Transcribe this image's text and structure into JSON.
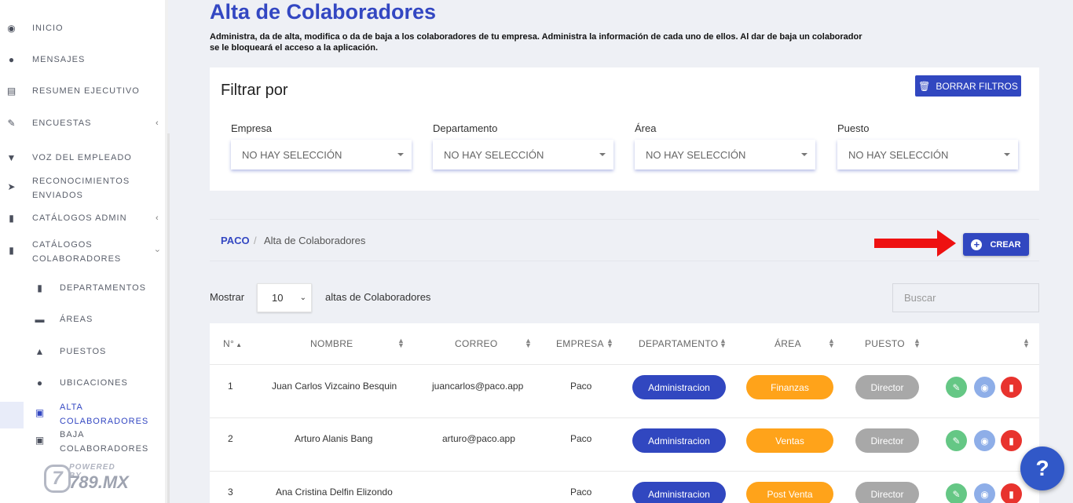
{
  "sidebar": {
    "items": [
      {
        "label": "INICIO",
        "icon": "dashboard-icon"
      },
      {
        "label": "MENSAJES",
        "icon": "chat-bubble-icon"
      },
      {
        "label": "RESUMEN EJECUTIVO",
        "icon": "bar-chart-icon"
      },
      {
        "label": "ENCUESTAS",
        "icon": "edit-icon"
      },
      {
        "label": "VOZ DEL EMPLEADO",
        "icon": "microphone-icon"
      },
      {
        "label_line1": "RECONOCIMIENTOS",
        "label_line2": "ENVIADOS",
        "icon": "paper-plane-icon"
      },
      {
        "label": "CATÁLOGOS ADMIN",
        "icon": "book-icon"
      },
      {
        "label_line1": "CATÁLOGOS",
        "label_line2": "COLABORADORES",
        "icon": "book-icon"
      }
    ],
    "subitems": [
      {
        "label": "DEPARTAMENTOS",
        "icon": "bookmark-icon"
      },
      {
        "label": "ÁREAS",
        "icon": "folder-open-icon"
      },
      {
        "label": "PUESTOS",
        "icon": "sitemap-icon"
      },
      {
        "label": "UBICACIONES",
        "icon": "map-marker-icon"
      },
      {
        "label_line1": "ALTA",
        "label_line2": "COLABORADORES",
        "icon": "briefcase-icon"
      },
      {
        "label_line1": "BAJA",
        "label_line2": "COLABORADORES",
        "icon": "briefcase-icon"
      }
    ],
    "brand": {
      "powered": "POWERED BY",
      "name": "789.MX",
      "mark": "7"
    }
  },
  "page": {
    "title": "Alta de Colaboradores",
    "description": "Administra, da de alta, modifica o da de baja a los colaboradores de tu empresa. Administra la información de cada uno de ellos. Al dar de baja un colaborador se le bloqueará el acceso a la aplicación."
  },
  "filters": {
    "title": "Filtrar por",
    "clear_label": "BORRAR FILTROS",
    "fields": [
      {
        "label": "Empresa",
        "value": "NO HAY SELECCIÓN"
      },
      {
        "label": "Departamento",
        "value": "NO HAY SELECCIÓN"
      },
      {
        "label": "Área",
        "value": "NO HAY SELECCIÓN"
      },
      {
        "label": "Puesto",
        "value": "NO HAY SELECCIÓN"
      }
    ]
  },
  "breadcrumb": {
    "home": "PACO",
    "separator": "/",
    "current": "Alta de Colaboradores"
  },
  "create_label": "CREAR",
  "table_controls": {
    "show_label": "Mostrar",
    "page_length": "10",
    "suffix": "altas de Colaboradores",
    "search_placeholder": "Buscar"
  },
  "table": {
    "headers": [
      "N°",
      "NOMBRE",
      "CORREO",
      "EMPRESA",
      "DEPARTAMENTO",
      "ÁREA",
      "PUESTO"
    ],
    "rows": [
      {
        "n": "1",
        "nombre": "Juan Carlos Vizcaino Besquin",
        "correo": "juancarlos@paco.app",
        "empresa": "Paco",
        "departamento": "Administracion",
        "area": "Finanzas",
        "puesto": "Director"
      },
      {
        "n": "2",
        "nombre": "Arturo Alanis Bang",
        "correo": "arturo@paco.app",
        "empresa": "Paco",
        "departamento": "Administracion",
        "area": "Ventas",
        "puesto": "Director"
      },
      {
        "n": "3",
        "nombre": "Ana Cristina Delfin Elizondo",
        "correo": "",
        "empresa": "Paco",
        "departamento": "Administracion",
        "area": "Post Venta",
        "puesto": "Director"
      }
    ]
  },
  "help_label": "?",
  "colors": {
    "primary": "#3147c0",
    "area": "#ffa31a",
    "puesto": "#a8a8a8",
    "edit": "#65c785",
    "view": "#8eaee8",
    "delete": "#e8332e",
    "arrow": "#ee1111"
  }
}
